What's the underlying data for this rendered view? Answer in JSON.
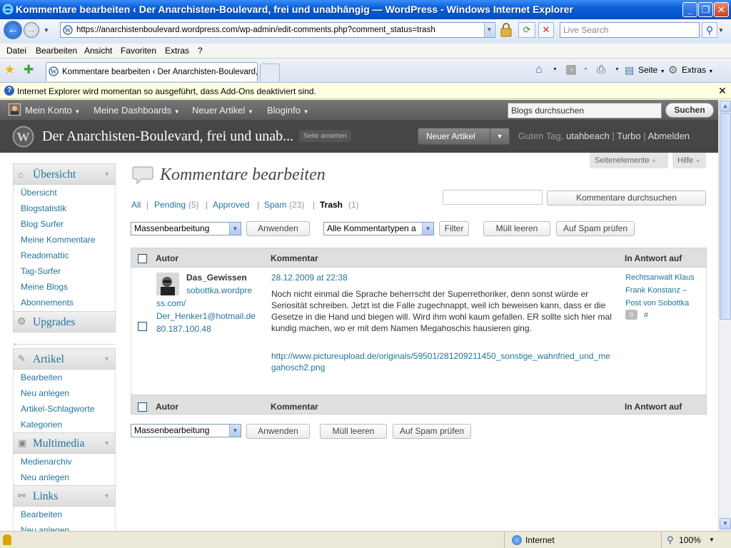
{
  "window": {
    "title": "Kommentare bearbeiten ‹ Der Anarchisten-Boulevard, frei und unabhängig — WordPress - Windows Internet Explorer"
  },
  "browser": {
    "url": "https://anarchistenboulevard.wordpress.com/wp-admin/edit-comments.php?comment_status=trash",
    "search_placeholder": "Live Search",
    "menu": [
      "Datei",
      "Bearbeiten",
      "Ansicht",
      "Favoriten",
      "Extras",
      "?"
    ],
    "tab_title": "Kommentare bearbeiten ‹ Der Anarchisten-Boulevard, ...",
    "toolbar": {
      "page_label": "Seite",
      "tools_label": "Extras"
    },
    "infobar": "Internet Explorer wird momentan so ausgeführt, dass Add-Ons deaktiviert sind.",
    "status": {
      "zone": "Internet",
      "zoom": "100%"
    }
  },
  "adminbar": {
    "my_account": "Mein Konto",
    "dashboards": "Meine Dashboards",
    "new_post": "Neuer Artikel",
    "bloginfo": "Bloginfo",
    "search_value": "Blogs durchsuchen",
    "search_button": "Suchen"
  },
  "header": {
    "blog_title": "Der Anarchisten-Boulevard, frei und unab...",
    "view_site": "Seite ansehen",
    "new_post_button": "Neuer Artikel",
    "greeting_prefix": "Guten Tag,",
    "username": "utahbeach",
    "turbo": "Turbo",
    "logout": "Abmelden",
    "screen_options": "Seitenelemente",
    "help": "Hilfe"
  },
  "sidebar": {
    "overview": {
      "label": "Übersicht",
      "items": [
        "Übersicht",
        "Blogstatistik",
        "Blog Surfer",
        "Meine Kommentare",
        "Readomattic",
        "Tag-Surfer",
        "Meine Blogs",
        "Abonnements"
      ]
    },
    "upgrades": "Upgrades",
    "posts": {
      "label": "Artikel",
      "items": [
        "Bearbeiten",
        "Neu anlegen",
        "Artikel-Schlagworte",
        "Kategorien"
      ]
    },
    "media": {
      "label": "Multimedia",
      "items": [
        "Medienarchiv",
        "Neu anlegen"
      ]
    },
    "links": {
      "label": "Links",
      "items": [
        "Bearbeiten",
        "Neu anlegen"
      ]
    }
  },
  "page": {
    "title": "Kommentare bearbeiten",
    "filters": {
      "all": "All",
      "pending": "Pending",
      "pending_count": "(5)",
      "approved": "Approved",
      "spam": "Spam",
      "spam_count": "(23)",
      "trash": "Trash",
      "trash_count": "(1)"
    },
    "search_value": "",
    "search_button": "Kommentare durchsuchen",
    "bulk_select": "Massenbearbeitung",
    "apply": "Anwenden",
    "type_select": "Alle Kommentartypen a",
    "filter": "Filter",
    "empty_trash": "Müll leeren",
    "check_spam": "Auf Spam prüfen",
    "columns": {
      "author": "Autor",
      "comment": "Kommentar",
      "reply_to": "In Antwort auf"
    }
  },
  "comment": {
    "author": "Das_Gewissen",
    "url_line1": "sobottka.wordpre",
    "url_line2": "ss.com/",
    "email": "Der_Henker1@hotmail.de",
    "ip": "80.187.100.48",
    "date": "28.12.2009 at 22:38",
    "text": "Noch nicht einmal die Sprache beherrscht der Superrethoriker, denn sonst würde er Seriosität schreiben. Jetzt ist die Falle zugechnappt, weil ich beweisen kann, dass er die Gesetze in die Hand und biegen will. Wird ihm wohl kaum gefallen. ER sollte sich hier mal kundig machen, wo er mit dem Namen Megahoschis hausieren ging.",
    "link": "http://www.pictureupload.de/originals/59501/281209211450_sonstige_wahnfried_und_megahosch2.png",
    "reply_post": "Rechtsanwalt Klaus Frank Konstanz – Post von Sobottka",
    "reply_count": "0",
    "permalink": "#"
  }
}
